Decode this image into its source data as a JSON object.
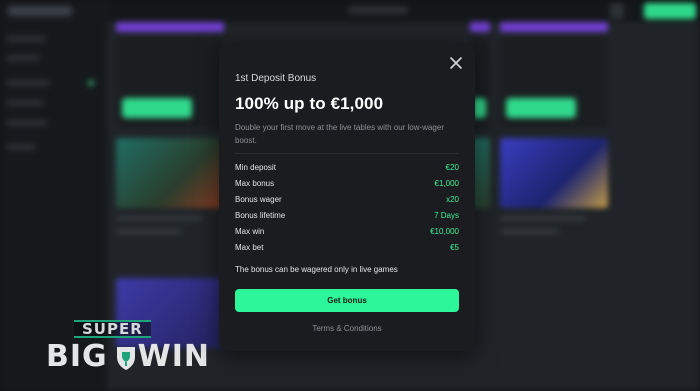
{
  "modal": {
    "kicker": "1st Deposit Bonus",
    "title": "100% up to €1,000",
    "description": "Double your first move at the live tables with our low-wager boost.",
    "rows": [
      {
        "label": "Min deposit",
        "value": "€20"
      },
      {
        "label": "Max bonus",
        "value": "€1,000"
      },
      {
        "label": "Bonus wager",
        "value": "x20"
      },
      {
        "label": "Bonus lifetime",
        "value": "7 Days"
      },
      {
        "label": "Max win",
        "value": "€10,000"
      },
      {
        "label": "Max bet",
        "value": "€5"
      }
    ],
    "note": "The bonus can be wagered only in live games",
    "cta_label": "Get bonus",
    "terms_label": "Terms & Conditions",
    "close_icon": "close-icon"
  },
  "watermark": {
    "top": "SUPER",
    "left": "BIG",
    "right": "WIN"
  },
  "colors": {
    "accent": "#2cf59a",
    "value_green": "#3ff09a",
    "modal_bg": "#1a1c1f",
    "backdrop": "#0f1214",
    "promo_strip": "#6f3fd0"
  }
}
